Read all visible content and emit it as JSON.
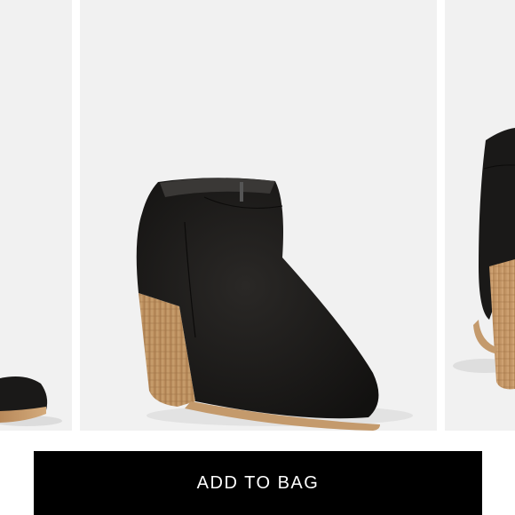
{
  "product": {
    "images": [
      {
        "icon": "ankle-boot-image",
        "description_visible": false
      },
      {
        "icon": "ankle-boot-image",
        "description_visible": false
      },
      {
        "icon": "ankle-boot-image",
        "description_visible": false
      }
    ]
  },
  "actions": {
    "add_to_bag_label": "ADD TO BAG"
  },
  "colors": {
    "button_bg": "#000000",
    "button_text": "#ffffff",
    "image_bg": "#f1f1f1",
    "boot_suede": "#1a1918",
    "heel_wood": "#c49a6c"
  }
}
